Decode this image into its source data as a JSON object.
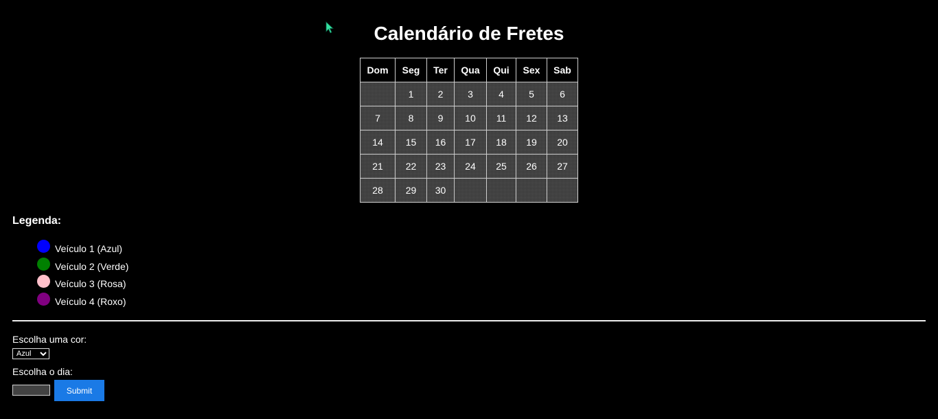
{
  "page": {
    "title": "Calendário de Fretes"
  },
  "calendar": {
    "weekdays": [
      "Dom",
      "Seg",
      "Ter",
      "Qua",
      "Qui",
      "Sex",
      "Sab"
    ],
    "weeks": [
      [
        "",
        "1",
        "2",
        "3",
        "4",
        "5",
        "6"
      ],
      [
        "7",
        "8",
        "9",
        "10",
        "11",
        "12",
        "13"
      ],
      [
        "14",
        "15",
        "16",
        "17",
        "18",
        "19",
        "20"
      ],
      [
        "21",
        "22",
        "23",
        "24",
        "25",
        "26",
        "27"
      ],
      [
        "28",
        "29",
        "30",
        "",
        "",
        "",
        ""
      ]
    ]
  },
  "legend": {
    "title": "Legenda:",
    "items": [
      {
        "label": "Veículo 1 (Azul)",
        "color": "#0000ff"
      },
      {
        "label": "Veículo 2 (Verde)",
        "color": "#008000"
      },
      {
        "label": "Veículo 3 (Rosa)",
        "color": "#ffc0cb"
      },
      {
        "label": "Veículo 4 (Roxo)",
        "color": "#800080"
      }
    ]
  },
  "form": {
    "color_label": "Escolha uma cor:",
    "color_selected": "Azul",
    "day_label": "Escolha o dia:",
    "day_value": "",
    "submit_label": "Submit"
  },
  "colors": {
    "background": "#000000",
    "submit_button": "#1a7ae6",
    "cursor": "#33e0a0"
  }
}
